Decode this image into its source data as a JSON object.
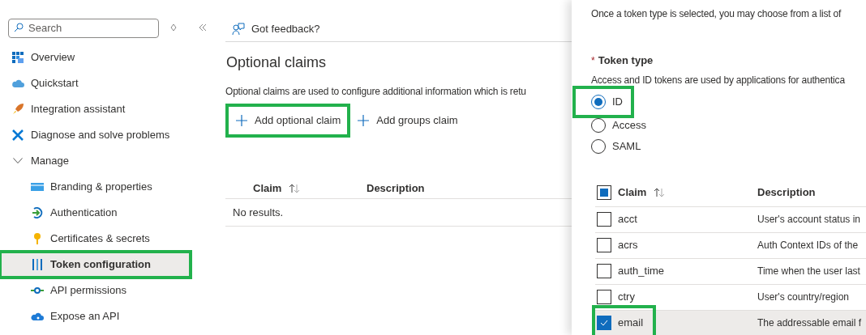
{
  "sidebar": {
    "search": {
      "placeholder": "Search"
    },
    "items": [
      {
        "label": "Overview",
        "selected": false,
        "highlighted": false
      },
      {
        "label": "Quickstart",
        "selected": false,
        "highlighted": false
      },
      {
        "label": "Integration assistant",
        "selected": false,
        "highlighted": false
      },
      {
        "label": "Diagnose and solve problems",
        "selected": false,
        "highlighted": false
      },
      {
        "label": "Manage",
        "expanded": true,
        "children": [
          {
            "label": "Branding & properties",
            "selected": false,
            "highlighted": false
          },
          {
            "label": "Authentication",
            "selected": false,
            "highlighted": false
          },
          {
            "label": "Certificates & secrets",
            "selected": false,
            "highlighted": false
          },
          {
            "label": "Token configuration",
            "selected": true,
            "highlighted": true
          },
          {
            "label": "API permissions",
            "selected": false,
            "highlighted": false
          },
          {
            "label": "Expose an API",
            "selected": false,
            "highlighted": false
          }
        ]
      }
    ]
  },
  "main": {
    "feedback": "Got feedback?",
    "title": "Optional claims",
    "description": "Optional claims are used to configure additional information which is retu",
    "actions": [
      {
        "label": "Add optional claim",
        "highlighted": true
      },
      {
        "label": "Add groups claim",
        "highlighted": false
      }
    ],
    "table": {
      "columns": [
        {
          "label": "Claim",
          "sortable": true
        },
        {
          "label": "Description",
          "sortable": false
        }
      ],
      "empty": "No results."
    }
  },
  "panel": {
    "intro": "Once a token type is selected, you may choose from a list of",
    "token_type": {
      "label": "Token type",
      "required_mark": "*",
      "description": "Access and ID tokens are used by applications for authentica",
      "options": [
        {
          "label": "ID",
          "selected": true,
          "highlighted": true
        },
        {
          "label": "Access",
          "selected": false,
          "highlighted": false
        },
        {
          "label": "SAML",
          "selected": false,
          "highlighted": false
        }
      ]
    },
    "claims": {
      "select_all_indeterminate": true,
      "columns": [
        {
          "label": "Claim",
          "sortable": true
        },
        {
          "label": "Description",
          "sortable": false
        }
      ],
      "rows": [
        {
          "claim": "acct",
          "description": "User's account status in",
          "checked": false,
          "highlighted": false
        },
        {
          "claim": "acrs",
          "description": "Auth Context IDs of the",
          "checked": false,
          "highlighted": false
        },
        {
          "claim": "auth_time",
          "description": "Time when the user last",
          "checked": false,
          "highlighted": false
        },
        {
          "claim": "ctry",
          "description": "User's country/region",
          "checked": false,
          "highlighted": false
        },
        {
          "claim": "email",
          "description": "The addressable email f",
          "checked": true,
          "highlighted": true
        }
      ]
    }
  }
}
